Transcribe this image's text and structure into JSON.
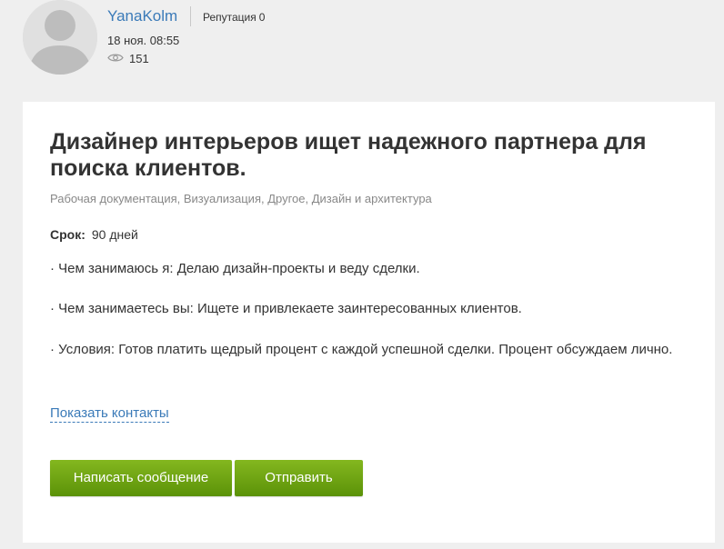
{
  "author": {
    "username": "YanaKolm",
    "reputation_label": "Репутация",
    "reputation_value": "0",
    "date": "18 ноя. 08:55",
    "views": "151",
    "avatar_icon": "user-silhouette-icon",
    "views_icon": "eye-icon"
  },
  "post": {
    "title": "Дизайнер интерьеров ищет надежного партнера для поиска клиентов.",
    "categories": "Рабочая документация, Визуализация, Другое, Дизайн и архитектура",
    "term_label": "Срок:",
    "term_value": "90 дней",
    "description": [
      "· Чем занимаюсь я: Делаю дизайн-проекты и веду сделки.",
      "· Чем занимаетесь вы: Ищете и привлекаете заинтересованных клиентов.",
      "· Условия: Готов платить щедрый процент с каждой успешной сделки. Процент обсуждаем лично."
    ],
    "show_contacts": "Показать контакты"
  },
  "actions": {
    "message_button": "Написать сообщение",
    "send_button": "Отправить"
  },
  "colors": {
    "page_background": "#efefef",
    "card_background": "#ffffff",
    "link": "#3a7ab8",
    "button_green": "#6fa512",
    "muted_text": "#888888"
  }
}
